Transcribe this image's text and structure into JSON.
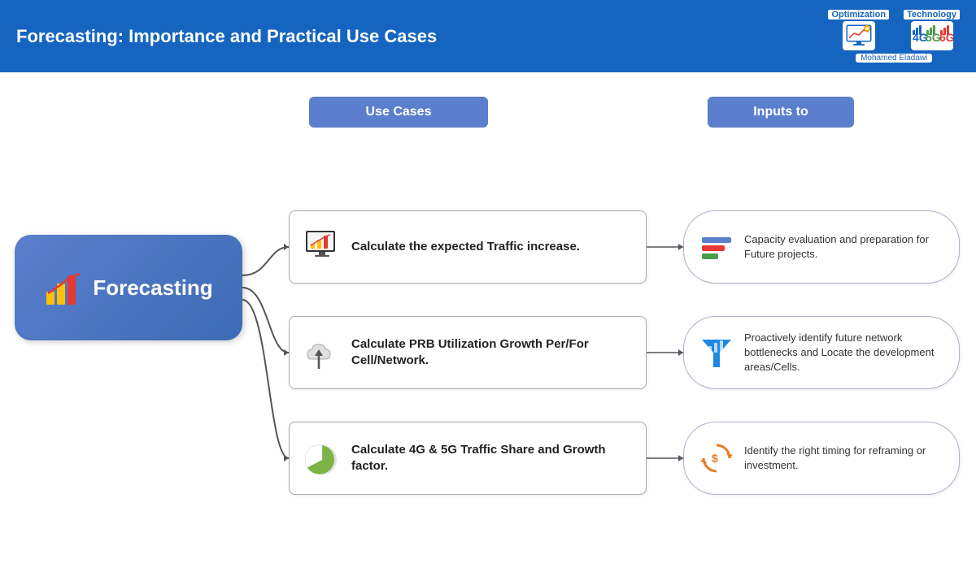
{
  "header": {
    "title": "Forecasting: Importance and Practical Use Cases",
    "logo_opt_label": "Optimization",
    "logo_tech_label": "Technology",
    "author": "Mohamed Eladawi"
  },
  "col_headers": {
    "use_cases": "Use Cases",
    "inputs_to": "Inputs to"
  },
  "central_node": {
    "label": "Forecasting"
  },
  "use_cases": [
    {
      "id": 1,
      "text": "Calculate the expected Traffic increase."
    },
    {
      "id": 2,
      "text": "Calculate PRB Utilization Growth Per/For Cell/Network."
    },
    {
      "id": 3,
      "text": "Calculate 4G & 5G Traffic Share and Growth factor."
    }
  ],
  "inputs": [
    {
      "id": 1,
      "text": "Capacity evaluation and preparation for Future projects."
    },
    {
      "id": 2,
      "text": "Proactively identify future network bottlenecks and Locate the development areas/Cells."
    },
    {
      "id": 3,
      "text": "Identify the right timing for reframing or investment."
    }
  ]
}
